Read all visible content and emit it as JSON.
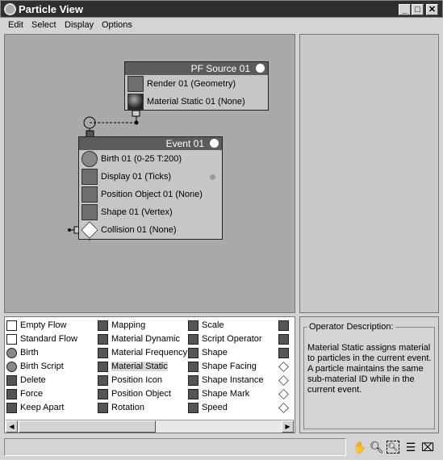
{
  "window": {
    "title": "Particle View",
    "controls": [
      "_",
      "□",
      "✕"
    ]
  },
  "menu": [
    "Edit",
    "Select",
    "Display",
    "Options"
  ],
  "graph": {
    "source_node": {
      "title": "PF Source 01",
      "operators": [
        {
          "label": "Render 01 (Geometry)",
          "icon": "render-teapot-icon"
        },
        {
          "label": "Material Static 01 (None)",
          "icon": "material-sphere-icon"
        }
      ]
    },
    "event_node": {
      "title": "Event 01",
      "operators": [
        {
          "label": "Birth 01 (0-25 T:200)",
          "icon": "birth-icon"
        },
        {
          "label": "Display 01 (Ticks)",
          "icon": "display-icon"
        },
        {
          "label": "Position Object 01 (None)",
          "icon": "position-icon"
        },
        {
          "label": "Shape 01 (Vertex)",
          "icon": "shape-cube-icon"
        },
        {
          "label": "Collision 01 (None)",
          "icon": "collision-diamond-icon"
        }
      ]
    }
  },
  "depot": {
    "columns": [
      [
        "Empty Flow",
        "Standard Flow",
        "Birth",
        "Birth Script",
        "Delete",
        "Force",
        "Keep Apart"
      ],
      [
        "Mapping",
        "Material Dynamic",
        "Material Frequency",
        "Material Static",
        "Position Icon",
        "Position Object",
        "Rotation"
      ],
      [
        "Scale",
        "Script Operator",
        "Shape",
        "Shape Facing",
        "Shape Instance",
        "Shape Mark",
        "Speed"
      ]
    ],
    "selected": "Material Static"
  },
  "description": {
    "title": "Operator Description:",
    "text": "Material Static assigns material to particles in the current event.  A particle maintains the same sub-material ID while in the current event."
  },
  "toolbar": [
    "pan-icon",
    "zoom-icon",
    "zoom-region-icon",
    "zoom-extents-icon",
    "no-zoom-icon"
  ]
}
